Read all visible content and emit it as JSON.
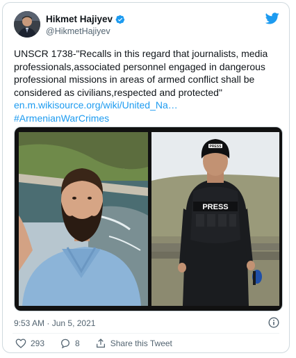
{
  "author": {
    "name": "Hikmet Hajiyev",
    "handle": "@HikmetHajiyev",
    "verified_icon": "verified-badge-icon",
    "platform_icon": "twitter-bird-icon"
  },
  "tweet": {
    "lines": [
      "UNSCR 1738-\"Recalls in this regard that journalists, media",
      "professionals,associated personnel engaged in dangerous",
      "professional missions in areas of armed conflict shall be",
      "considered as civilians,respected and protected\""
    ],
    "link_text": "en.m.wikisource.org/wiki/United_Na…",
    "hashtag": "#ArmenianWarCrimes",
    "vest_label": "PRESS",
    "helmet_label": "PRESS"
  },
  "meta": {
    "time": "9:53 AM",
    "separator": "·",
    "date": "Jun 5, 2021"
  },
  "actions": {
    "likes": "293",
    "replies": "8",
    "share_label": "Share this Tweet"
  },
  "colors": {
    "accent": "#1d9bf0",
    "secondary_text": "#536471",
    "like": "#536471"
  }
}
